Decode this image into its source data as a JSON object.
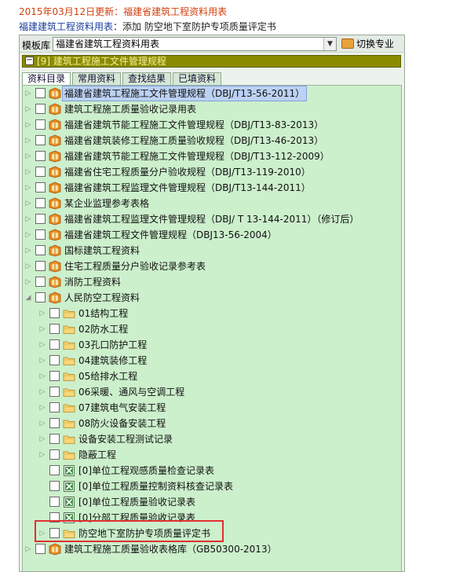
{
  "update_notice": "2015年03月12日更新：福建省建筑工程资料用表",
  "breadcrumb": {
    "link": "福建建筑工程资料用表",
    "sep": "：",
    "action": "添加 防空地下室防护专项质量评定书"
  },
  "template_bar": {
    "label": "模板库",
    "selected": "福建省建筑工程资料用表",
    "switch_label": "切换专业"
  },
  "section_title": "[9] 建筑工程施工文件管理规程",
  "tabs": [
    "资料目录",
    "常用资料",
    "查找结果",
    "已填资料"
  ],
  "active_tab": 0,
  "tree": [
    {
      "level": 0,
      "icon": "book-icon",
      "arrow": "collapsed",
      "label": "福建省建筑工程施工文件管理规程（DBJ/T13-56-2011）",
      "selected": true
    },
    {
      "level": 0,
      "icon": "book-icon",
      "arrow": "collapsed",
      "label": "建筑工程施工质量验收记录用表"
    },
    {
      "level": 0,
      "icon": "book-icon",
      "arrow": "collapsed",
      "label": "福建省建筑节能工程施工文件管理规程（DBJ/T13-83-2013）"
    },
    {
      "level": 0,
      "icon": "book-icon",
      "arrow": "collapsed",
      "label": "福建省建筑装修工程施工质量验收规程（DBJ/T13-46-2013）"
    },
    {
      "level": 0,
      "icon": "book-icon",
      "arrow": "collapsed",
      "label": "福建省建筑节能工程施工文件管理规程（DBJ/T13-112-2009）"
    },
    {
      "level": 0,
      "icon": "book-icon",
      "arrow": "collapsed",
      "label": "福建省住宅工程质量分户验收规程（DBJ/T13-119-2010）"
    },
    {
      "level": 0,
      "icon": "book-icon",
      "arrow": "collapsed",
      "label": "福建省建筑工程监理文件管理规程（DBJ/T13-144-2011）"
    },
    {
      "level": 0,
      "icon": "book-icon",
      "arrow": "collapsed",
      "label": "某企业监理参考表格"
    },
    {
      "level": 0,
      "icon": "book-icon",
      "arrow": "collapsed",
      "label": "福建省建筑工程监理文件管理规程（DBJ/ T 13-144-2011）（修订后）"
    },
    {
      "level": 0,
      "icon": "book-icon",
      "arrow": "collapsed",
      "label": "福建省建筑工程文件管理规程（DBJ13-56-2004）"
    },
    {
      "level": 0,
      "icon": "book-icon",
      "arrow": "collapsed",
      "label": "国标建筑工程资料"
    },
    {
      "level": 0,
      "icon": "book-icon",
      "arrow": "collapsed",
      "label": "住宅工程质量分户验收记录参考表"
    },
    {
      "level": 0,
      "icon": "book-icon",
      "arrow": "collapsed",
      "label": "消防工程资料"
    },
    {
      "level": 0,
      "icon": "book-icon",
      "arrow": "expanded",
      "label": "人民防空工程资料"
    },
    {
      "level": 1,
      "icon": "folder-icon",
      "arrow": "collapsed",
      "label": "01结构工程"
    },
    {
      "level": 1,
      "icon": "folder-icon",
      "arrow": "collapsed",
      "label": "02防水工程"
    },
    {
      "level": 1,
      "icon": "folder-icon",
      "arrow": "collapsed",
      "label": "03孔口防护工程"
    },
    {
      "level": 1,
      "icon": "folder-icon",
      "arrow": "collapsed",
      "label": "04建筑装修工程"
    },
    {
      "level": 1,
      "icon": "folder-icon",
      "arrow": "collapsed",
      "label": "05给排水工程"
    },
    {
      "level": 1,
      "icon": "folder-icon",
      "arrow": "collapsed",
      "label": "06采暖、通风与空调工程"
    },
    {
      "level": 1,
      "icon": "folder-icon",
      "arrow": "collapsed",
      "label": "07建筑电气安装工程"
    },
    {
      "level": 1,
      "icon": "folder-icon",
      "arrow": "collapsed",
      "label": "08防火设备安装工程"
    },
    {
      "level": 1,
      "icon": "folder-icon",
      "arrow": "collapsed",
      "label": "设备安装工程测试记录"
    },
    {
      "level": 1,
      "icon": "folder-icon",
      "arrow": "collapsed",
      "label": "隐蔽工程"
    },
    {
      "level": 1,
      "icon": "sheet-icon",
      "arrow": "none",
      "label": "[0]单位工程观感质量检查记录表"
    },
    {
      "level": 1,
      "icon": "sheet-icon",
      "arrow": "none",
      "label": "[0]单位工程质量控制资料核查记录表"
    },
    {
      "level": 1,
      "icon": "sheet-icon",
      "arrow": "none",
      "label": "[0]单位工程质量验收记录表"
    },
    {
      "level": 1,
      "icon": "sheet-icon",
      "arrow": "none",
      "label": "[0]分部工程质量验收记录表"
    },
    {
      "level": 1,
      "icon": "folder-icon",
      "arrow": "collapsed",
      "label": "防空地下室防护专项质量评定书",
      "highlighted": true
    },
    {
      "level": 0,
      "icon": "book-icon",
      "arrow": "collapsed",
      "label": "建筑工程施工质量验收表格库（GB50300-2013）"
    }
  ],
  "colors": {
    "update_text": "#d04010",
    "section_bar": "#8b8b00",
    "tree_bg": "#ccefcc",
    "highlight_border": "#e03030",
    "selected_row": "#bcd2f4"
  }
}
